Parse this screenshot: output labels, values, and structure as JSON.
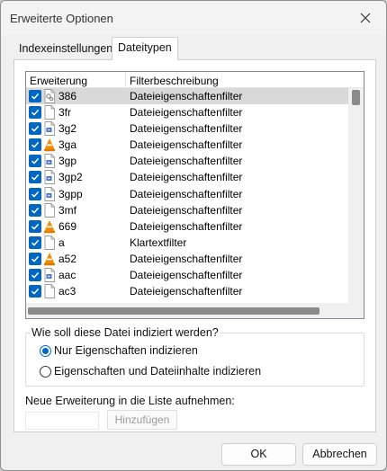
{
  "window": {
    "title": "Erweiterte Optionen"
  },
  "tabs": [
    {
      "label": "Indexeinstellungen"
    },
    {
      "label": "Dateitypen"
    }
  ],
  "list": {
    "columns": {
      "extension": "Erweiterung",
      "filter": "Filterbeschreibung"
    },
    "rows": [
      {
        "ext": "386",
        "filter": "Dateieigenschaftenfilter",
        "icon": "settings-file",
        "checked": true,
        "selected": true
      },
      {
        "ext": "3fr",
        "filter": "Dateieigenschaftenfilter",
        "icon": "blank-file",
        "checked": true
      },
      {
        "ext": "3g2",
        "filter": "Dateieigenschaftenfilter",
        "icon": "media-file",
        "checked": true
      },
      {
        "ext": "3ga",
        "filter": "Dateieigenschaftenfilter",
        "icon": "vlc",
        "checked": true
      },
      {
        "ext": "3gp",
        "filter": "Dateieigenschaftenfilter",
        "icon": "media-file",
        "checked": true
      },
      {
        "ext": "3gp2",
        "filter": "Dateieigenschaftenfilter",
        "icon": "media-file",
        "checked": true
      },
      {
        "ext": "3gpp",
        "filter": "Dateieigenschaftenfilter",
        "icon": "media-file",
        "checked": true
      },
      {
        "ext": "3mf",
        "filter": "Dateieigenschaftenfilter",
        "icon": "blank-file",
        "checked": true
      },
      {
        "ext": "669",
        "filter": "Dateieigenschaftenfilter",
        "icon": "vlc",
        "checked": true
      },
      {
        "ext": "a",
        "filter": "Klartextfilter",
        "icon": "blank-file",
        "checked": true
      },
      {
        "ext": "a52",
        "filter": "Dateieigenschaftenfilter",
        "icon": "vlc",
        "checked": true
      },
      {
        "ext": "aac",
        "filter": "Dateieigenschaftenfilter",
        "icon": "media-file",
        "checked": true
      },
      {
        "ext": "ac3",
        "filter": "Dateieigenschaftenfilter",
        "icon": "blank-file",
        "checked": true
      }
    ]
  },
  "indexing": {
    "question": "Wie soll diese Datei indiziert werden?",
    "option1": "Nur Eigenschaften indizieren",
    "option2": "Eigenschaften und Dateiinhalte indizieren",
    "selected": 1
  },
  "add_extension": {
    "label": "Neue Erweiterung in die Liste aufnehmen:",
    "value": "",
    "button": "Hinzufügen"
  },
  "buttons": {
    "ok": "OK",
    "cancel": "Abbrechen"
  },
  "colors": {
    "accent": "#0067c0",
    "vlc_orange": "#f08a00"
  }
}
